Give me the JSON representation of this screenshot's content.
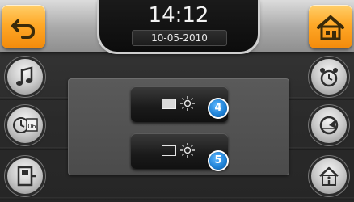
{
  "header": {
    "time": "14:12",
    "date": "10-05-2010",
    "back_icon": "back-arrow-icon",
    "home_icon": "home-icon"
  },
  "left_menu": [
    {
      "icon": "music-icon"
    },
    {
      "icon": "clock-calendar-icon",
      "text": "06"
    },
    {
      "icon": "door-exit-icon"
    }
  ],
  "right_menu": [
    {
      "icon": "alarm-clock-icon"
    },
    {
      "icon": "gauge-icon"
    },
    {
      "icon": "house-info-icon"
    }
  ],
  "controls": [
    {
      "icon": "display-filled-icon",
      "secondary_icon": "brightness-sun-icon",
      "badge": "4"
    },
    {
      "icon": "display-outline-icon",
      "secondary_icon": "brightness-sun-icon",
      "badge": "5"
    }
  ],
  "colors": {
    "accent_orange": "#F7A11A",
    "badge_blue": "#1C7FD4",
    "panel_gray": "#555555",
    "background": "#2B2B2B"
  }
}
